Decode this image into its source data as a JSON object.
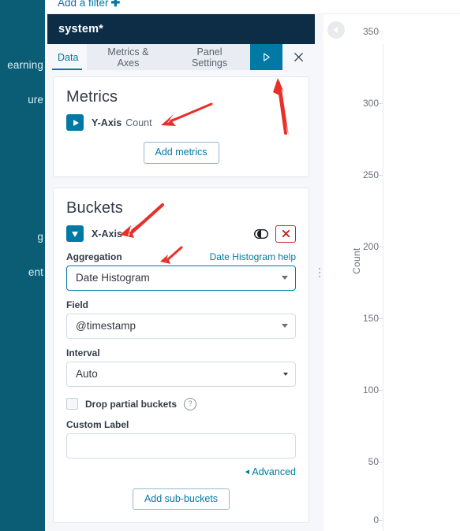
{
  "global_nav": {
    "items": [
      {
        "label": "earning",
        "top": 75
      },
      {
        "label": "ure",
        "top": 119
      },
      {
        "label": "g",
        "top": 293
      },
      {
        "label": "ent",
        "top": 338
      }
    ],
    "background_color": "#0b5d76"
  },
  "filter_bar": {
    "add_filter_label": "Add a filter",
    "plus_glyph": "✚"
  },
  "editor": {
    "title": "system*",
    "title_bar_color": "#0d2c45",
    "tabs": [
      {
        "label": "Data",
        "active": true
      },
      {
        "label": "Metrics & Axes",
        "active": false
      },
      {
        "label": "Panel Settings",
        "active": false
      }
    ],
    "apply_button": {
      "icon": "play-triangle-icon",
      "color": "#0079a5"
    },
    "close_button": {
      "icon": "close-x-icon"
    },
    "metrics": {
      "title": "Metrics",
      "rows": [
        {
          "toggle_icon": "triangle-right-icon",
          "label": "Y-Axis",
          "sublabel": "Count"
        }
      ],
      "add_button_label": "Add metrics"
    },
    "buckets": {
      "title": "Buckets",
      "row": {
        "toggle_icon": "triangle-down-icon",
        "label": "X-Axis",
        "disable_toggle_icon": "toggle-switch-icon",
        "remove_icon": "remove-x-icon",
        "remove_color": "#bd271e"
      },
      "aggregation_label": "Aggregation",
      "aggregation_help_link": "Date Histogram help",
      "aggregation_value": "Date Histogram",
      "field_label": "Field",
      "field_value": "@timestamp",
      "interval_label": "Interval",
      "interval_value": "Auto",
      "drop_partial_label": "Drop partial buckets",
      "drop_partial_checked": false,
      "drop_partial_help_glyph": "?",
      "custom_label_label": "Custom Label",
      "custom_label_value": "",
      "advanced_label": "Advanced",
      "add_sub_buckets_label": "Add sub-buckets"
    }
  },
  "chart_panel": {
    "collapse_button_icon": "chevron-left-icon",
    "resize_handle_icon": "drag-handle-icon"
  },
  "chart_data": {
    "type": "bar",
    "title": "",
    "xlabel": "",
    "ylabel": "Count",
    "yticks": [
      350,
      300,
      250,
      200,
      150,
      100,
      50,
      0
    ],
    "ylim": [
      0,
      350
    ],
    "grid": false,
    "legend": "none",
    "categories": [],
    "values": [],
    "note": "Chart panel is clipped at the right edge of the screenshot; only the y-axis (Count) with ticks 0-350 is visible, no plotted bars are within view."
  },
  "annotations": {
    "arrows": [
      {
        "name": "arrow-to-y-axis-metric",
        "color": "#e8302a"
      },
      {
        "name": "arrow-to-apply-button",
        "color": "#e8302a"
      },
      {
        "name": "arrow-to-x-axis-bucket",
        "color": "#e8302a"
      },
      {
        "name": "arrow-to-aggregation-select",
        "color": "#e8302a"
      }
    ]
  }
}
